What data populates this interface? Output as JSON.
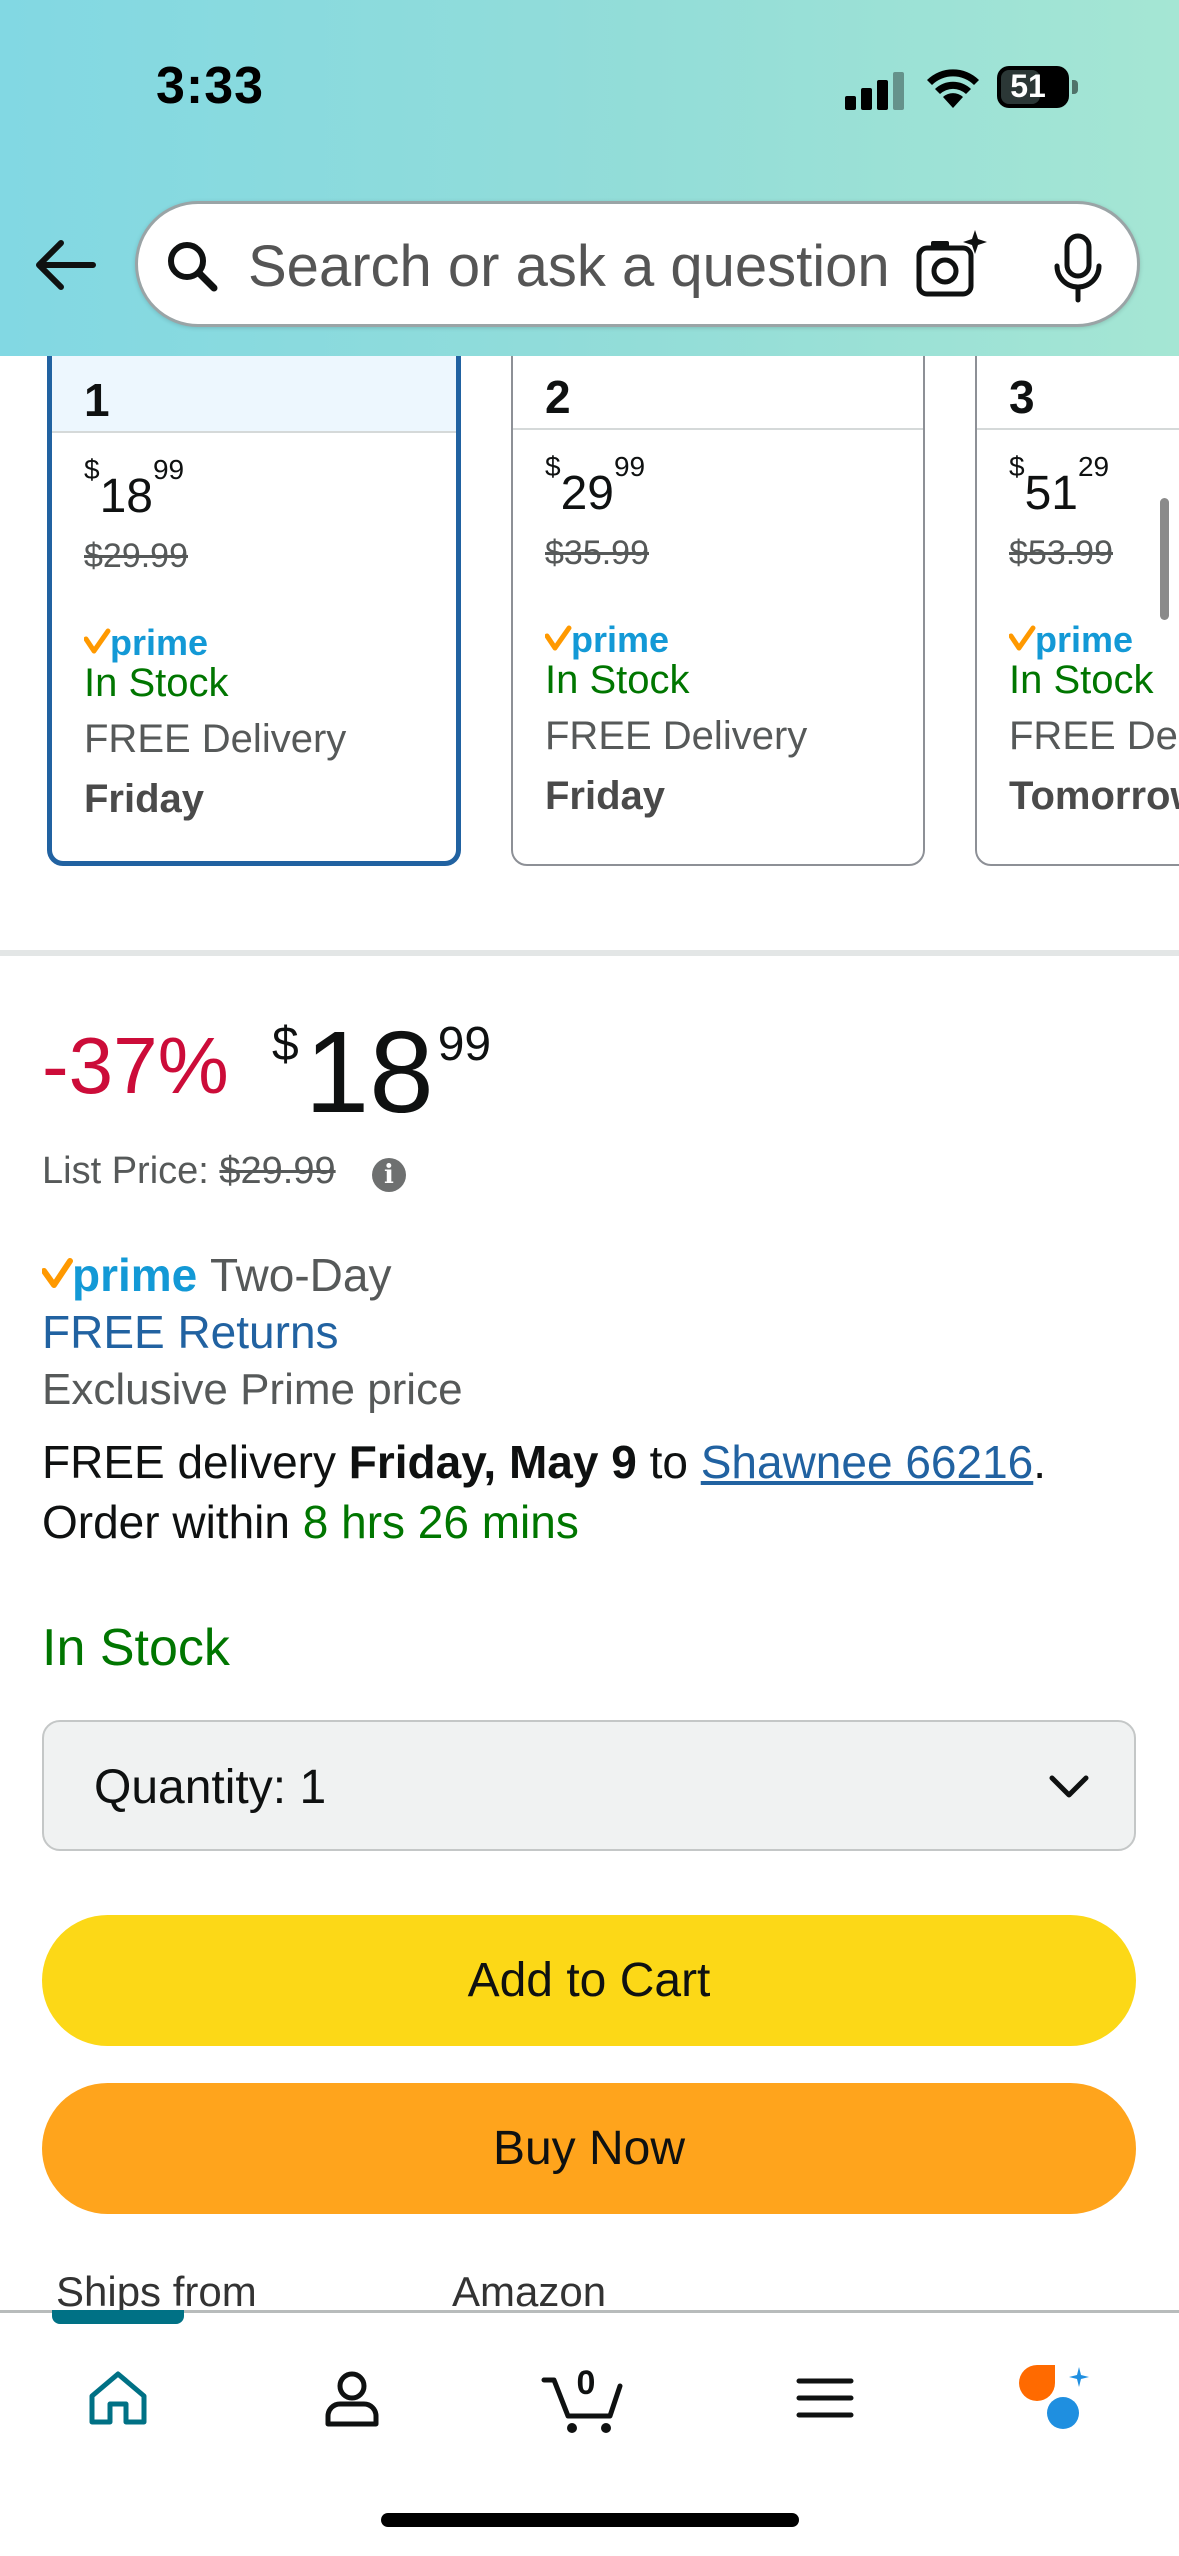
{
  "status_bar": {
    "time": "3:33",
    "battery": "51"
  },
  "search": {
    "placeholder": "Search or ask a question"
  },
  "cards": [
    {
      "number": "1",
      "price_currency": "$",
      "price_whole": "18",
      "price_cents": "99",
      "original": "$29.99",
      "prime": "prime",
      "stock": "In Stock",
      "delivery": "FREE Delivery",
      "day": "Friday",
      "selected": true
    },
    {
      "number": "2",
      "price_currency": "$",
      "price_whole": "29",
      "price_cents": "99",
      "original": "$35.99",
      "prime": "prime",
      "stock": "In Stock",
      "delivery": "FREE Delivery",
      "day": "Friday",
      "selected": false
    },
    {
      "number": "3",
      "price_currency": "$",
      "price_whole": "51",
      "price_cents": "29",
      "original": "$53.99",
      "prime": "prime",
      "stock": "In Stock",
      "delivery": "FREE Delivery",
      "day": "Tomorrow",
      "selected": false
    }
  ],
  "price": {
    "discount": "-37%",
    "currency": "$",
    "whole": "18",
    "cents": "99",
    "list_label": "List Price:",
    "list_value": "$29.99"
  },
  "prime_info": {
    "prime": "prime",
    "two_day": "Two-Day",
    "free_returns": "FREE Returns",
    "exclusive": "Exclusive Prime price"
  },
  "delivery": {
    "prefix": "FREE delivery ",
    "date": "Friday, May 9",
    "to": " to ",
    "location": "Shawnee 66216",
    "period": ".",
    "order_prefix": "Order within ",
    "order_timer": "8 hrs 26 mins"
  },
  "availability": "In Stock",
  "quantity": {
    "label": "Quantity:",
    "value": "1"
  },
  "buttons": {
    "add_to_cart": "Add to Cart",
    "buy_now": "Buy Now"
  },
  "ships_from": {
    "label": "Ships from",
    "value": "Amazon"
  },
  "nav": {
    "cart_count": "0",
    "items": [
      "home-icon",
      "account-icon",
      "cart-icon",
      "menu-icon",
      "rufus-icon"
    ]
  },
  "colors": {
    "accent_teal": "#007185",
    "deal_red": "#cc0c39",
    "stock_green": "#007600",
    "link_blue": "#2162a1",
    "cart_yellow": "#fcd817",
    "buy_orange": "#ffa41c"
  }
}
